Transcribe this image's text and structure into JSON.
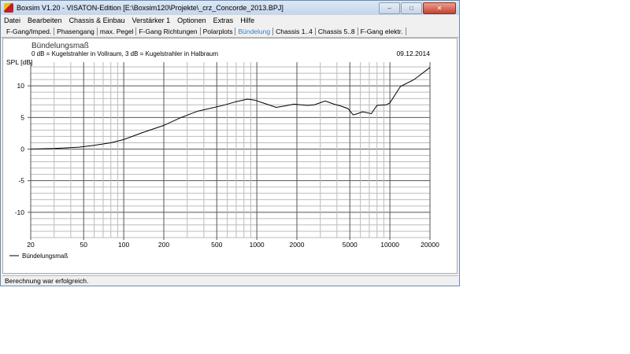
{
  "window": {
    "title": "Boxsim V1.20 - VISATON-Edition [E:\\Boxsim120\\Projekte\\_crz_Concorde_2013.BPJ]",
    "min": "–",
    "max": "□",
    "close": "✕"
  },
  "menu": [
    "Datei",
    "Bearbeiten",
    "Chassis & Einbau",
    "Verstärker 1",
    "Optionen",
    "Extras",
    "Hilfe"
  ],
  "tabs": [
    "F-Gang/Imped.",
    "Phasengang",
    "max. Pegel",
    "F-Gang Richtungen",
    "Polarplots",
    "Bündelung",
    "Chassis 1..4",
    "Chassis 5..8",
    "F-Gang elektr."
  ],
  "active_tab": 5,
  "status": "Berechnung war erfolgreich.",
  "chart_data": {
    "type": "line",
    "title": "Bündelungsmaß",
    "subtitle": "0 dB = Kugelstrahler in Vollraum, 3 dB = Kugelstrahler in Halbraum",
    "date": "09.12.2014",
    "ylabel": "SPL [dB]",
    "xlabel": "",
    "xscale": "log",
    "xlim": [
      20,
      20000
    ],
    "ylim": [
      -14,
      13.75
    ],
    "xticks": [
      20,
      50,
      100,
      200,
      500,
      1000,
      2000,
      5000,
      10000,
      20000
    ],
    "yticks": [
      10,
      5,
      0,
      -5,
      -10
    ],
    "grid": true,
    "legend": {
      "placement": "bottom-left",
      "entries": [
        "Bündelungsmaß"
      ]
    },
    "series": [
      {
        "name": "Bündelungsmaß",
        "color": "#000000",
        "x": [
          20,
          30,
          46,
          60,
          80,
          100,
          138,
          200,
          270,
          360,
          460,
          580,
          700,
          850,
          960,
          1150,
          1400,
          1600,
          1900,
          2400,
          2700,
          3266,
          3800,
          4300,
          4850,
          5300,
          5700,
          6240,
          7250,
          8000,
          9400,
          10000,
          12000,
          15200,
          20000
        ],
        "y": [
          0,
          0.1,
          0.3,
          0.6,
          1.0,
          1.5,
          2.6,
          3.75,
          5.0,
          6.0,
          6.5,
          7.0,
          7.5,
          7.9,
          7.75,
          7.2,
          6.6,
          6.8,
          7.1,
          6.9,
          7.0,
          7.6,
          7.1,
          6.8,
          6.4,
          5.4,
          5.6,
          5.9,
          5.6,
          6.9,
          7.0,
          7.3,
          9.9,
          11.0,
          12.9
        ]
      }
    ]
  }
}
